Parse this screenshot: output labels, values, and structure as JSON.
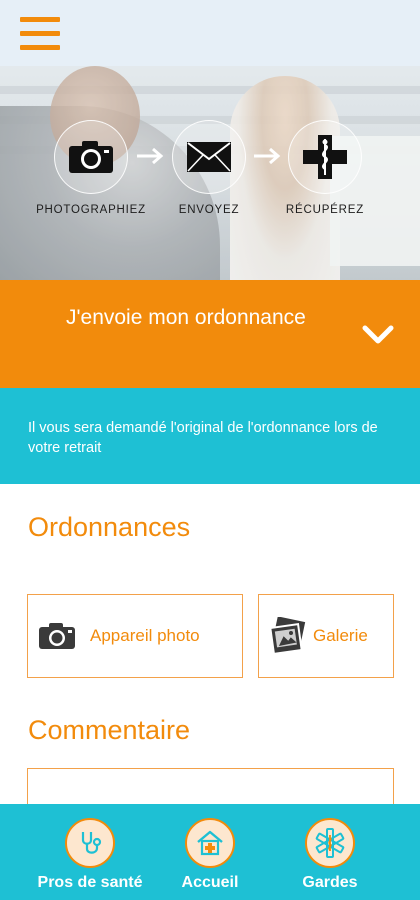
{
  "header": {
    "menu_icon": "hamburger-menu-icon",
    "accent": "#f28b0c"
  },
  "steps": [
    {
      "label": "PHOTOGRAPHIEZ",
      "icon": "camera-icon"
    },
    {
      "label": "ENVOYEZ",
      "icon": "envelope-icon"
    },
    {
      "label": "RÉCUPÉREZ",
      "icon": "pharmacy-cross-icon"
    }
  ],
  "banner": {
    "title": "J'envoie mon ordonnance",
    "icon": "chevron-down-icon",
    "color": "#f28b0c"
  },
  "info": {
    "text": "Il vous sera demandé l'original de l'ordonnance lors de votre retrait",
    "color": "#1ec0d4"
  },
  "prescriptions": {
    "title": "Ordonnances",
    "camera_label": "Appareil photo",
    "gallery_label": "Galerie"
  },
  "comment": {
    "title": "Commentaire",
    "value": ""
  },
  "bottom_nav": [
    {
      "label": "Pros de santé",
      "icon": "stethoscope-icon"
    },
    {
      "label": "Accueil",
      "icon": "home-pharmacy-icon"
    },
    {
      "label": "Gardes",
      "icon": "star-of-life-icon"
    }
  ]
}
